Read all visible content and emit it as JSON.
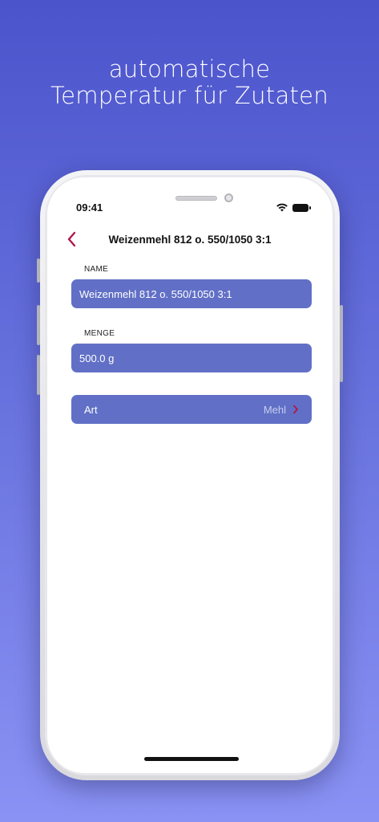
{
  "promo": {
    "line1": "automatische",
    "line2": "Temperatur für Zutaten"
  },
  "status_bar": {
    "time": "09:41",
    "icons": [
      "wifi-icon",
      "battery-icon"
    ]
  },
  "nav": {
    "back_icon": "chevron-left-icon",
    "title": "Weizenmehl 812 o. 550/1050 3:1"
  },
  "form": {
    "name_label": "NAME",
    "name_value": "Weizenmehl 812 o. 550/1050 3:1",
    "menge_label": "MENGE",
    "menge_value": "500.0 g",
    "art_label": "Art",
    "art_value": "Mehl",
    "art_icon": "chevron-right-icon"
  },
  "colors": {
    "accent": "#b0174a",
    "field_bg": "#6170c6",
    "background_top": "#4c54cc",
    "background_bottom": "#8a92f4"
  }
}
